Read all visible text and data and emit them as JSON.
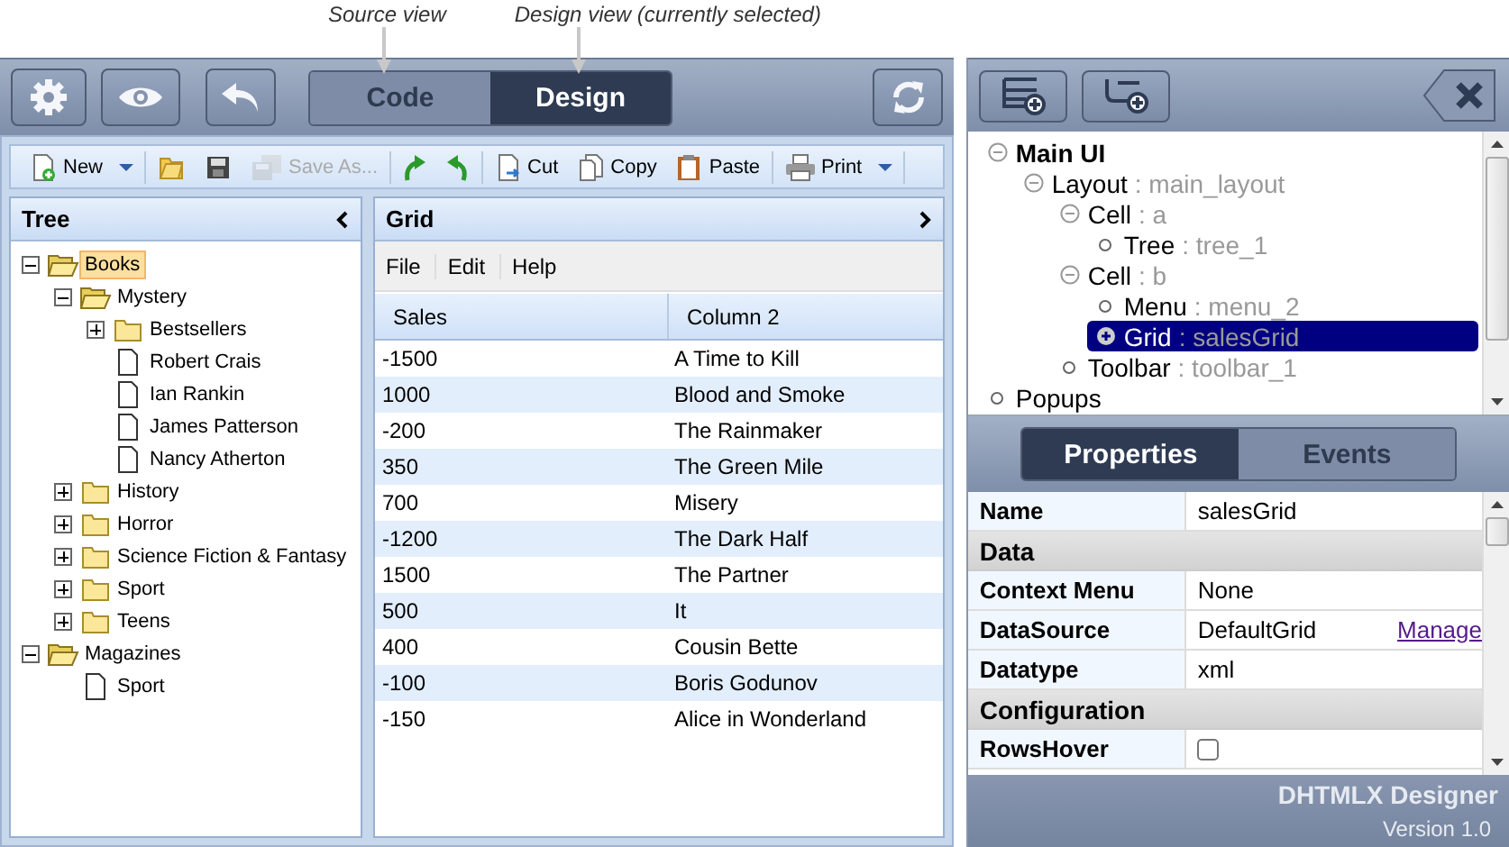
{
  "captions": [
    {
      "text": "Source view"
    },
    {
      "text": "Design view (currently selected)"
    }
  ],
  "view_tabs": [
    {
      "label": "Code",
      "selected": false
    },
    {
      "label": "Design",
      "selected": true
    }
  ],
  "toolbar": [
    {
      "kind": "new",
      "label": "New",
      "dropdown": true,
      "disabled": false
    },
    {
      "kind": "open",
      "disabled": false
    },
    {
      "kind": "save",
      "disabled": false
    },
    {
      "kind": "saveas",
      "label": "Save As...",
      "disabled": true
    },
    {
      "kind": "redo",
      "disabled": false
    },
    {
      "kind": "undo",
      "disabled": false
    },
    {
      "kind": "cut",
      "label": "Cut",
      "disabled": false
    },
    {
      "kind": "copy",
      "label": "Copy",
      "disabled": false
    },
    {
      "kind": "paste",
      "label": "Paste",
      "disabled": false
    },
    {
      "kind": "print",
      "label": "Print",
      "dropdown": true,
      "disabled": false
    }
  ],
  "tree_panel": {
    "title": "Tree",
    "nodes": [
      {
        "kind": "folder",
        "label": "Books",
        "expanded": true,
        "selected": true,
        "children": [
          {
            "kind": "folder",
            "label": "Mystery",
            "expanded": true,
            "selected": false,
            "children": [
              {
                "kind": "folder",
                "label": "Bestsellers",
                "expanded": false,
                "selected": false
              },
              {
                "kind": "file",
                "label": "Robert Crais",
                "selected": false
              },
              {
                "kind": "file",
                "label": "Ian Rankin",
                "selected": false
              },
              {
                "kind": "file",
                "label": "James Patterson",
                "selected": false
              },
              {
                "kind": "file",
                "label": "Nancy Atherton",
                "selected": false
              }
            ]
          },
          {
            "kind": "folder",
            "label": "History",
            "expanded": false,
            "selected": false
          },
          {
            "kind": "folder",
            "label": "Horror",
            "expanded": false,
            "selected": false
          },
          {
            "kind": "folder",
            "label": "Science Fiction & Fantasy",
            "expanded": false,
            "selected": false
          },
          {
            "kind": "folder",
            "label": "Sport",
            "expanded": false,
            "selected": false
          },
          {
            "kind": "folder",
            "label": "Teens",
            "expanded": false,
            "selected": false
          }
        ]
      },
      {
        "kind": "folder",
        "label": "Magazines",
        "expanded": true,
        "selected": false,
        "children": [
          {
            "kind": "file",
            "label": "Sport",
            "selected": false
          }
        ]
      }
    ]
  },
  "grid_panel": {
    "title": "Grid",
    "menu": [
      "File",
      "Edit",
      "Help"
    ],
    "columns": [
      "Sales",
      "Column 2"
    ],
    "rows": [
      [
        "-1500",
        "A Time to Kill"
      ],
      [
        "1000",
        "Blood and Smoke"
      ],
      [
        "-200",
        "The Rainmaker"
      ],
      [
        "350",
        "The Green Mile"
      ],
      [
        "700",
        "Misery"
      ],
      [
        "-1200",
        "The Dark Half"
      ],
      [
        "1500",
        "The Partner"
      ],
      [
        "500",
        "It"
      ],
      [
        "400",
        "Cousin Bette"
      ],
      [
        "-100",
        "Boris Godunov"
      ],
      [
        "-150",
        "Alice in Wonderland"
      ]
    ]
  },
  "structure": [
    {
      "kind": "node",
      "label": "Main UI",
      "expanded": true,
      "selected": false,
      "children": [
        {
          "kind": "node",
          "label": "Layout",
          "detail": ": main_layout",
          "expanded": true,
          "selected": false,
          "children": [
            {
              "kind": "node",
              "label": "Cell",
              "detail": ": a",
              "expanded": true,
              "selected": false,
              "children": [
                {
                  "kind": "leaf",
                  "label": "Tree",
                  "detail": ": tree_1",
                  "selected": false
                }
              ]
            },
            {
              "kind": "node",
              "label": "Cell",
              "detail": ": b",
              "expanded": true,
              "selected": false,
              "children": [
                {
                  "kind": "leaf",
                  "label": "Menu",
                  "detail": ": menu_2",
                  "selected": false
                },
                {
                  "kind": "node",
                  "label": "Grid",
                  "detail": ": salesGrid",
                  "expanded": false,
                  "selected": true
                }
              ]
            },
            {
              "kind": "leaf",
              "label": "Toolbar",
              "detail": ": toolbar_1",
              "selected": false
            }
          ]
        }
      ]
    },
    {
      "kind": "leaf",
      "label": "Popups",
      "selected": false
    }
  ],
  "inspector_tabs": [
    {
      "label": "Properties",
      "selected": true
    },
    {
      "label": "Events",
      "selected": false
    }
  ],
  "properties": [
    {
      "kind": "property",
      "label": "Name",
      "value": "salesGrid"
    },
    {
      "kind": "section",
      "label": "Data"
    },
    {
      "kind": "property",
      "label": "Context Menu",
      "value": "None"
    },
    {
      "kind": "property",
      "label": "DataSource",
      "value": "DefaultGrid",
      "link": "Manage"
    },
    {
      "kind": "property",
      "label": "Datatype",
      "value": "xml"
    },
    {
      "kind": "section",
      "label": "Configuration"
    },
    {
      "kind": "checkbox",
      "label": "RowsHover",
      "checked": false
    }
  ],
  "footer": {
    "title": "DHTMLX Designer",
    "version": "Version 1.0"
  }
}
